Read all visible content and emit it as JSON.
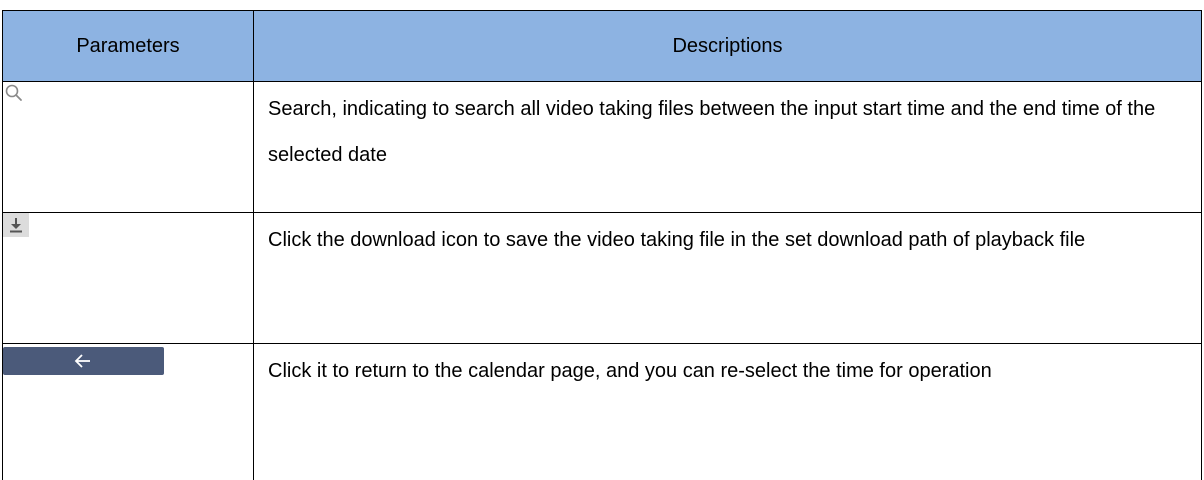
{
  "table": {
    "headers": [
      "Parameters",
      "Descriptions"
    ],
    "rows": [
      {
        "icon": "search-icon",
        "description": "Search, indicating to search all video taking files between the input start time and the end time of the selected date"
      },
      {
        "icon": "download-icon",
        "description": "Click the download icon to save the video taking file in the set download path of playback file"
      },
      {
        "icon": "back-arrow-button",
        "description": "Click it to return to the calendar page, and you can re-select the time for operation"
      }
    ]
  },
  "colors": {
    "header_background": "#8db3e2",
    "back_button_background": "#4b5a7a",
    "border": "#000000"
  }
}
